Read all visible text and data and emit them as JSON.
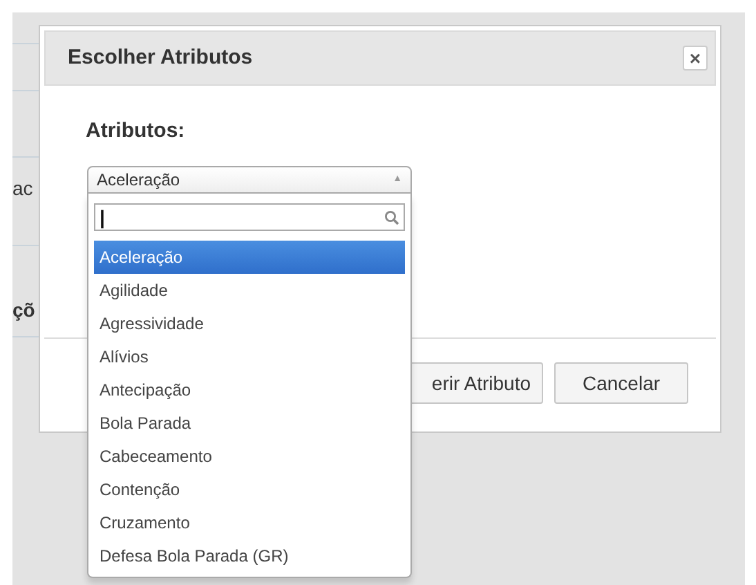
{
  "background_page": {
    "texts": [
      {
        "text": "ac",
        "bold": false
      },
      {
        "text": "çõ",
        "bold": true
      }
    ]
  },
  "dialog": {
    "title": "Escolher Atributos",
    "close_label": "×",
    "field_label": "Atributos:",
    "select": {
      "value": "Aceleração",
      "expanded": true,
      "arrow": "▲",
      "search": {
        "cursor": "|"
      },
      "options": [
        {
          "label": "Aceleração",
          "selected": true
        },
        {
          "label": "Agilidade",
          "selected": false
        },
        {
          "label": "Agressividade",
          "selected": false
        },
        {
          "label": "Alívios",
          "selected": false
        },
        {
          "label": "Antecipação",
          "selected": false
        },
        {
          "label": "Bola Parada",
          "selected": false
        },
        {
          "label": "Cabeceamento",
          "selected": false
        },
        {
          "label": "Contenção",
          "selected": false
        },
        {
          "label": "Cruzamento",
          "selected": false
        },
        {
          "label": "Defesa Bola Parada (GR)",
          "selected": false
        }
      ]
    },
    "buttons": [
      {
        "label": "erir Atributo"
      },
      {
        "label": "Cancelar"
      }
    ]
  }
}
